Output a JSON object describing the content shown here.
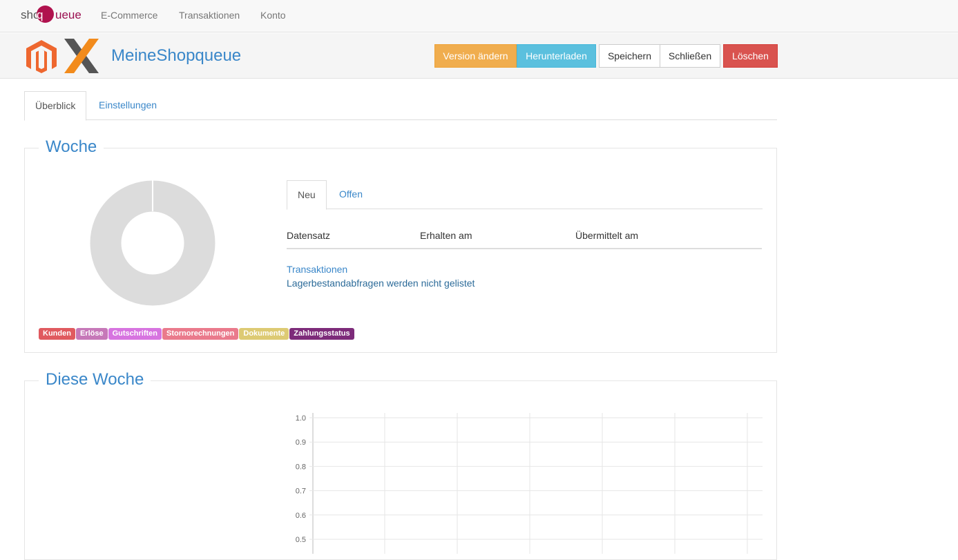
{
  "navbar": {
    "brand": {
      "part1": "shop",
      "part2": "q",
      "part3": "ueue"
    },
    "items": [
      "E-Commerce",
      "Transaktionen",
      "Konto"
    ]
  },
  "header": {
    "title": "MeineShopqueue",
    "buttons": {
      "version": "Version ändern",
      "download": "Herunterladen",
      "save": "Speichern",
      "close": "Schließen",
      "delete": "Löschen"
    },
    "colors": {
      "warning": "#f0ad4e",
      "info": "#5bc0de",
      "danger": "#d9534f",
      "accent": "#3a87c9"
    }
  },
  "tabs": [
    {
      "label": "Überblick",
      "active": true
    },
    {
      "label": "Einstellungen",
      "active": false
    }
  ],
  "week": {
    "legend": "Woche",
    "badges": [
      {
        "label": "Kunden",
        "color": "#e05a5f"
      },
      {
        "label": "Erlöse",
        "color": "#c678b8"
      },
      {
        "label": "Gutschriften",
        "color": "#d774e0"
      },
      {
        "label": "Stornorechnungen",
        "color": "#ea7a8c"
      },
      {
        "label": "Dokumente",
        "color": "#ddca73"
      },
      {
        "label": "Zahlungsstatus",
        "color": "#7d2b7a"
      }
    ],
    "subtabs": [
      {
        "label": "Neu",
        "active": true
      },
      {
        "label": "Offen",
        "active": false
      }
    ],
    "columns": [
      "Datensatz",
      "Erhalten am",
      "Übermittelt am"
    ],
    "link": "Transaktionen",
    "note": "Lagerbestandabfragen werden nicht gelistet"
  },
  "this_week": {
    "legend": "Diese Woche"
  },
  "chart_data": {
    "type": "line",
    "title": "",
    "xlabel": "",
    "ylabel": "",
    "y_ticks": [
      "1.0",
      "0.9",
      "0.8",
      "0.7",
      "0.6",
      "0.5"
    ],
    "ylim_visible": [
      0.5,
      1.0
    ],
    "series": [],
    "grid": true
  }
}
